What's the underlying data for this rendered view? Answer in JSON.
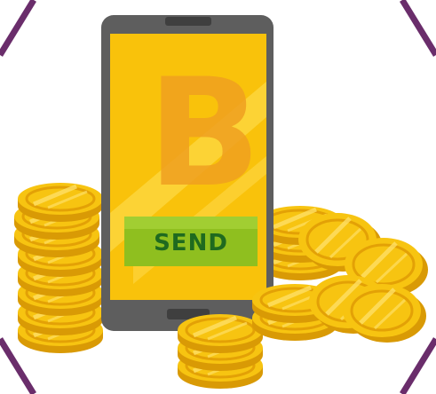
{
  "send_button": {
    "label": "SEND"
  },
  "logo": {
    "letter": "B"
  },
  "colors": {
    "frame": "#6a2d6b",
    "phone_body": "#5e5e5e",
    "screen": "#f9c20b",
    "logo_letter": "#f0a020",
    "button": "#8fbf1f",
    "button_text": "#1f6a1f",
    "coin_face": "#f7c411",
    "coin_edge": "#e3a106",
    "coin_stripe": "#ffe066"
  },
  "icons": [
    "smartphone-icon",
    "bitcoin-logo",
    "gold-coin-stack-icon"
  ]
}
